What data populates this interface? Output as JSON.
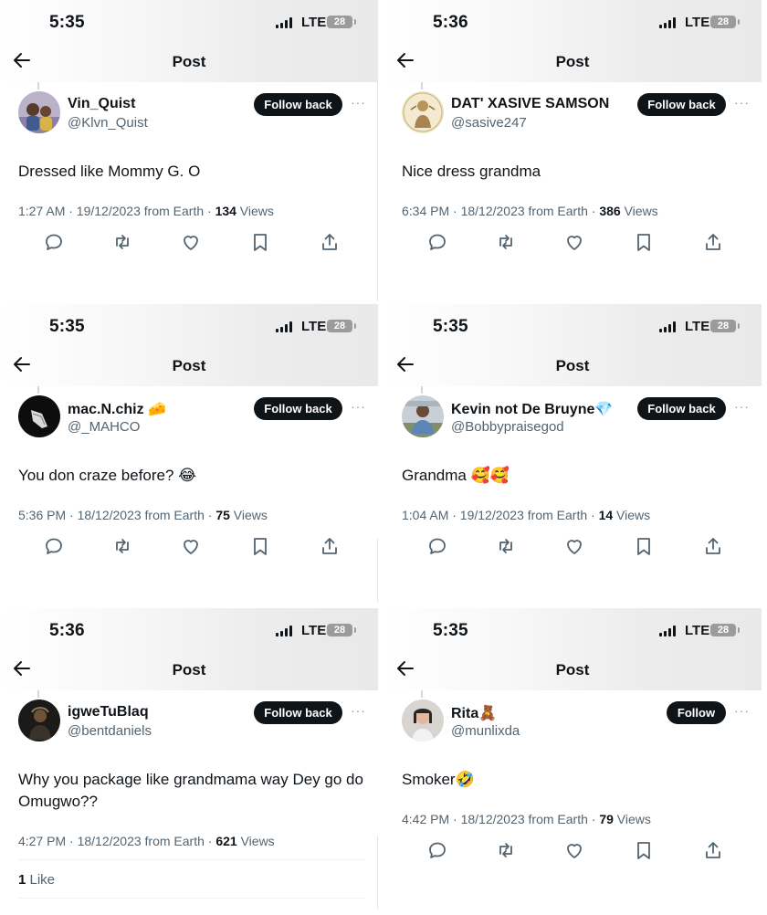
{
  "header_title": "Post",
  "status": {
    "carrier": "LTE",
    "battery": "28"
  },
  "posts": [
    {
      "time": "5:35",
      "name": "Vin_Quist",
      "handle": "@Klvn_Quist",
      "follow_label": "Follow back",
      "text": "Dressed like Mommy G. O",
      "meta": "1:27 AM · 19/12/2023 from Earth · ",
      "views": "134",
      "views_label": " Views"
    },
    {
      "time": "5:36",
      "name": "DAT' XASIVE SAMSON",
      "handle": "@sasive247",
      "follow_label": "Follow back",
      "text": "Nice dress grandma",
      "meta": "6:34 PM · 18/12/2023 from Earth · ",
      "views": "386",
      "views_label": " Views"
    },
    {
      "time": "5:35",
      "name": "mac.N.chiz 🧀",
      "handle": "@_MAHCO",
      "follow_label": "Follow back",
      "text": "You don craze before? 😂",
      "meta": "5:36 PM · 18/12/2023 from Earth · ",
      "views": "75",
      "views_label": " Views"
    },
    {
      "time": "5:35",
      "name": "Kevin not De Bruyne💎",
      "handle": "@Bobbypraisegod",
      "follow_label": "Follow back",
      "text": "Grandma 🥰🥰",
      "meta": "1:04 AM · 19/12/2023 from Earth · ",
      "views": "14",
      "views_label": " Views"
    },
    {
      "time": "5:36",
      "name": "igweTuBlaq",
      "handle": "@bentdaniels",
      "follow_label": "Follow back",
      "text": "Why you package like grandmama way Dey go do Omugwo??",
      "meta": "4:27 PM · 18/12/2023 from Earth · ",
      "views": "621",
      "views_label": " Views",
      "likes_count": "1",
      "likes_label": " Like"
    },
    {
      "time": "5:35",
      "name": "Rita🧸",
      "handle": "@munlixda",
      "follow_label": "Follow",
      "text": "Smoker🤣",
      "meta": "4:42 PM · 18/12/2023 from Earth · ",
      "views": "79",
      "views_label": " Views"
    }
  ],
  "icons": [
    "back-arrow-icon",
    "reply-icon",
    "repost-icon",
    "like-icon",
    "bookmark-icon",
    "share-icon",
    "more-icon"
  ]
}
